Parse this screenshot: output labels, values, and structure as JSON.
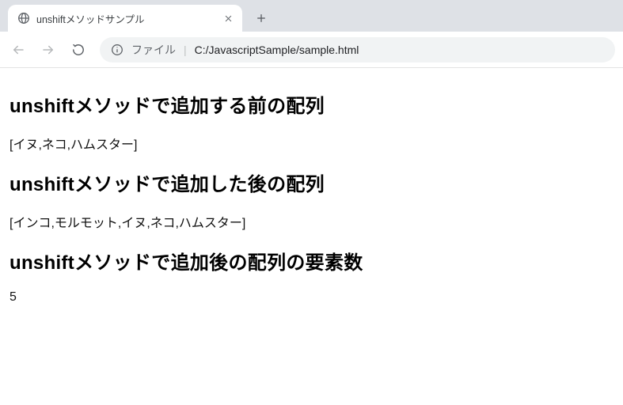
{
  "browser": {
    "tab_title": "unshiftメソッドサンプル",
    "url_prefix": "ファイル",
    "url_sep": "|",
    "url": "C:/JavascriptSample/sample.html"
  },
  "content": {
    "heading_before": "unshiftメソッドで追加する前の配列",
    "array_before": "[イヌ,ネコ,ハムスター]",
    "heading_after": "unshiftメソッドで追加した後の配列",
    "array_after": "[インコ,モルモット,イヌ,ネコ,ハムスター]",
    "heading_count": "unshiftメソッドで追加後の配列の要素数",
    "count": "5"
  }
}
